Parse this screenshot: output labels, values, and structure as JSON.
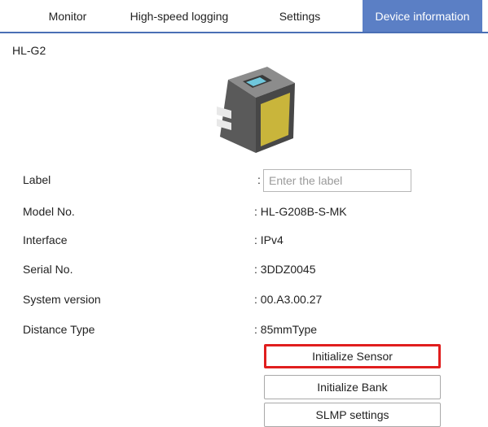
{
  "tabs": [
    {
      "label": "Monitor"
    },
    {
      "label": "High-speed logging"
    },
    {
      "label": "Settings"
    },
    {
      "label": "Device information",
      "active": true
    }
  ],
  "device": {
    "name": "HL-G2",
    "image_icon": "sensor-device-icon"
  },
  "info": {
    "label": {
      "label": "Label",
      "colon": ":",
      "placeholder": "Enter the label",
      "value": ""
    },
    "model": {
      "label": "Model No.",
      "value": ": HL-G208B-S-MK"
    },
    "interface": {
      "label": "Interface",
      "value": ": IPv4"
    },
    "serial": {
      "label": "Serial No.",
      "value": ": 3DDZ0045"
    },
    "system_version": {
      "label": "System version",
      "value": ": 00.A3.00.27"
    },
    "distance_type": {
      "label": "Distance Type",
      "value": ": 85mmType"
    }
  },
  "buttons": {
    "initialize_sensor": "Initialize Sensor",
    "initialize_bank": "Initialize Bank",
    "slmp_settings": "SLMP settings"
  },
  "colors": {
    "active_tab": "#5b7fc5",
    "highlight": "#e01e1e"
  }
}
